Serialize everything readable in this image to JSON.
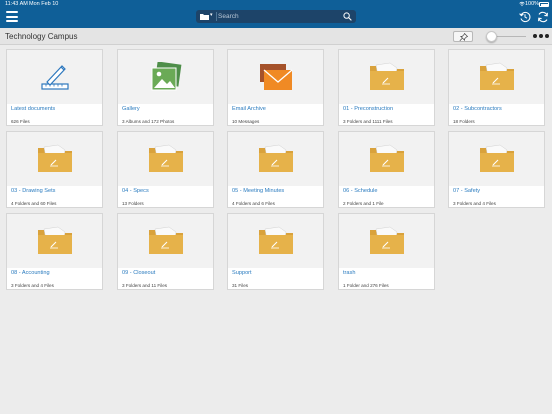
{
  "status_bar": {
    "time": "11:43 AM",
    "date": "Mon Feb 10",
    "battery": "100%"
  },
  "search": {
    "placeholder": "Search"
  },
  "header": {
    "title": "Technology Campus"
  },
  "colors": {
    "nav_bar": "#0f5f98",
    "link_text": "#2a7bbf",
    "folder": "#e6b24a"
  },
  "tiles": [
    {
      "label": "Latest documents",
      "sub": "626 Files",
      "icon": "ruler-pencil-icon"
    },
    {
      "label": "Gallery",
      "sub": "3 Albums and 172 Photos",
      "icon": "gallery-photo-icon"
    },
    {
      "label": "Email Archive",
      "sub": "10 Messages",
      "icon": "envelope-icon"
    },
    {
      "label": "01 - Preconstruction",
      "sub": "3 Folders and 1111 Files",
      "icon": "folder-icon"
    },
    {
      "label": "02 - Subcontractors",
      "sub": "18 Folders",
      "icon": "folder-icon"
    },
    {
      "label": "03 - Drawing Sets",
      "sub": "4 Folders and 60 Files",
      "icon": "folder-icon"
    },
    {
      "label": "04 - Specs",
      "sub": "13 Folders",
      "icon": "folder-icon"
    },
    {
      "label": "05 - Meeting Minutes",
      "sub": "4 Folders and 6 Files",
      "icon": "folder-icon"
    },
    {
      "label": "06 - Schedule",
      "sub": "2 Folders and 1 File",
      "icon": "folder-icon"
    },
    {
      "label": "07 - Safety",
      "sub": "3 Folders and 4 Files",
      "icon": "folder-icon"
    },
    {
      "label": "08 - Accounting",
      "sub": "3 Folders and 4 Files",
      "icon": "folder-icon"
    },
    {
      "label": "09 - Closeout",
      "sub": "3 Folders and 11 Files",
      "icon": "folder-icon"
    },
    {
      "label": "Support",
      "sub": "31 Files",
      "icon": "folder-icon"
    },
    {
      "label": "trash",
      "sub": "1 Folder and 276 Files",
      "icon": "folder-icon"
    }
  ]
}
